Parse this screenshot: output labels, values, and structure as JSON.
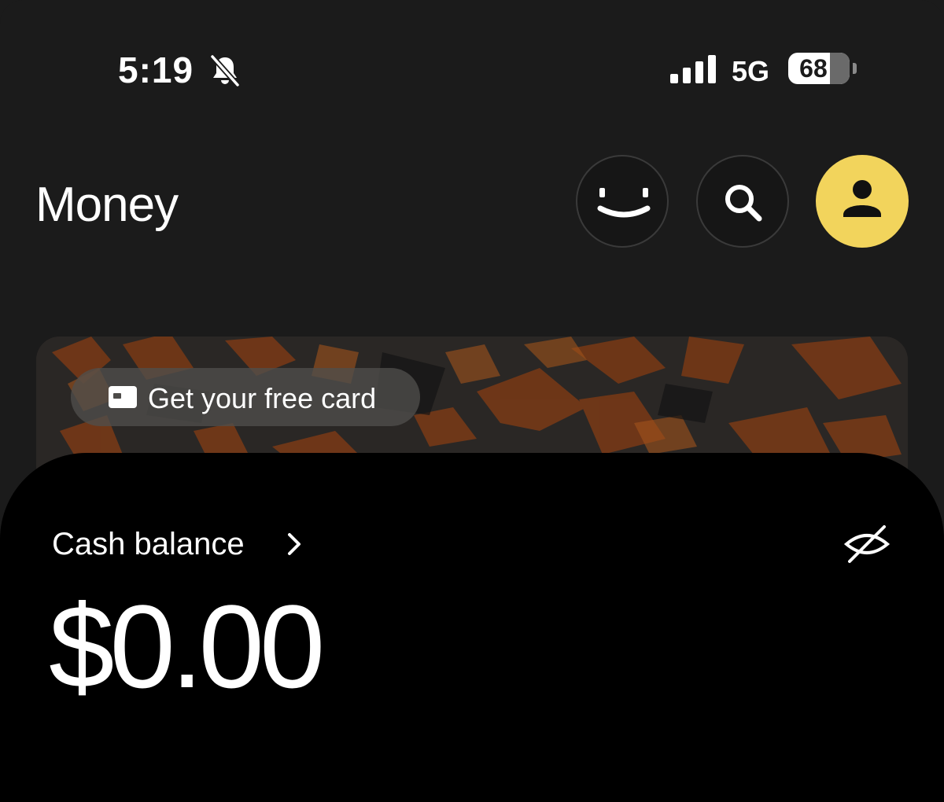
{
  "status_bar": {
    "time": "5:19",
    "network": "5G",
    "battery_level": "68",
    "battery_fraction": 0.68
  },
  "header": {
    "title": "Money",
    "profile_color": "#f2d45c"
  },
  "promo": {
    "label": "Get your free card"
  },
  "balance": {
    "label": "Cash balance",
    "amount": "$0.00"
  },
  "icons": [
    "bell-slash-icon",
    "signal-icon",
    "smile-icon",
    "search-icon",
    "person-icon",
    "card-icon",
    "chevron-right-icon",
    "eye-off-icon"
  ]
}
